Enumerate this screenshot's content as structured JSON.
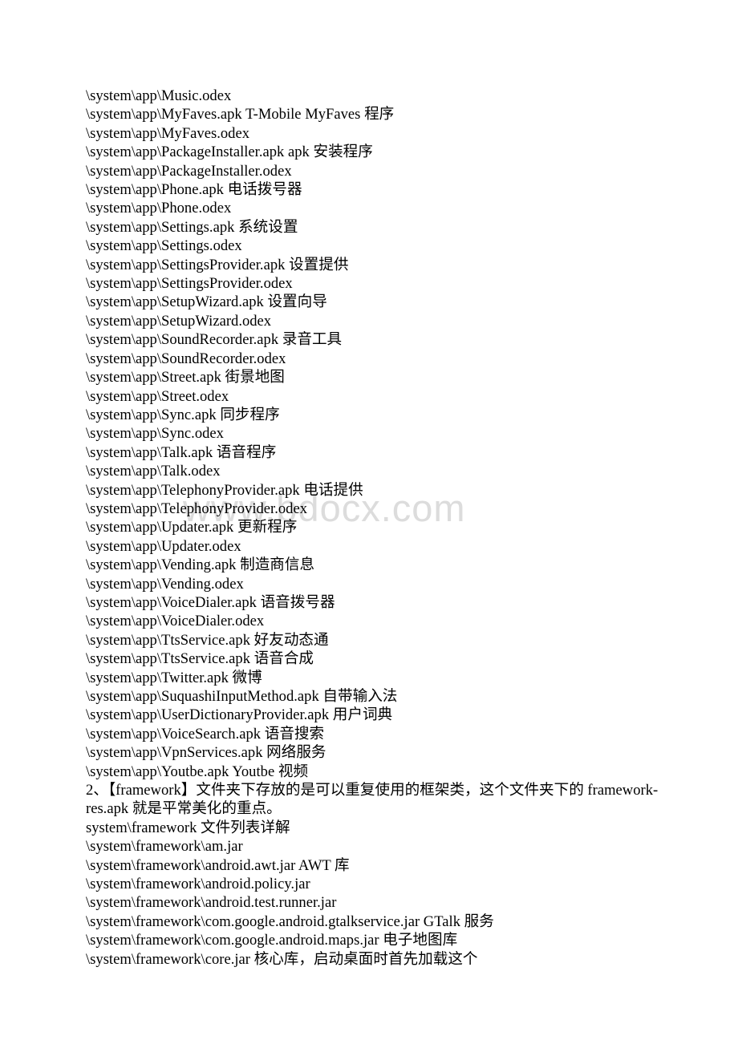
{
  "page": {
    "background_color": "#ffffff",
    "text_color": "#000000"
  },
  "watermark": {
    "text": "www.bdocx.com",
    "color": "#dcdcdc"
  },
  "body": {
    "lines": [
      "\\system\\app\\Music.odex",
      "\\system\\app\\MyFaves.apk T-Mobile MyFaves 程序",
      "\\system\\app\\MyFaves.odex",
      "\\system\\app\\PackageInstaller.apk apk 安装程序",
      "\\system\\app\\PackageInstaller.odex",
      "\\system\\app\\Phone.apk 电话拨号器",
      "\\system\\app\\Phone.odex",
      "\\system\\app\\Settings.apk 系统设置",
      "\\system\\app\\Settings.odex",
      "\\system\\app\\SettingsProvider.apk 设置提供",
      "\\system\\app\\SettingsProvider.odex",
      "\\system\\app\\SetupWizard.apk 设置向导",
      "\\system\\app\\SetupWizard.odex",
      "\\system\\app\\SoundRecorder.apk 录音工具",
      "\\system\\app\\SoundRecorder.odex",
      "\\system\\app\\Street.apk 街景地图",
      "\\system\\app\\Street.odex",
      "\\system\\app\\Sync.apk 同步程序",
      "\\system\\app\\Sync.odex",
      "\\system\\app\\Talk.apk 语音程序",
      "\\system\\app\\Talk.odex",
      "\\system\\app\\TelephonyProvider.apk 电话提供",
      "\\system\\app\\TelephonyProvider.odex",
      "\\system\\app\\Updater.apk 更新程序",
      "\\system\\app\\Updater.odex",
      "\\system\\app\\Vending.apk 制造商信息",
      "\\system\\app\\Vending.odex",
      "\\system\\app\\VoiceDialer.apk 语音拨号器",
      "\\system\\app\\VoiceDialer.odex",
      "\\system\\app\\TtsService.apk 好友动态通",
      "\\system\\app\\TtsService.apk 语音合成",
      "\\system\\app\\Twitter.apk 微博",
      "\\system\\app\\SuquashiInputMethod.apk 自带输入法",
      "\\system\\app\\UserDictionaryProvider.apk 用户词典",
      "\\system\\app\\VoiceSearch.apk 语音搜索",
      "\\system\\app\\VpnServices.apk 网络服务",
      "\\system\\app\\Youtbe.apk Youtbe 视频",
      "2、【framework】文件夹下存放的是可以重复使用的框架类，这个文件夹下的 framework-res.apk 就是平常美化的重点。",
      "system\\framework 文件列表详解",
      "\\system\\framework\\am.jar",
      "\\system\\framework\\android.awt.jar AWT 库",
      "\\system\\framework\\android.policy.jar",
      "\\system\\framework\\android.test.runner.jar",
      "\\system\\framework\\com.google.android.gtalkservice.jar GTalk 服务",
      "\\system\\framework\\com.google.android.maps.jar 电子地图库",
      "\\system\\framework\\core.jar 核心库，启动桌面时首先加载这个"
    ]
  }
}
